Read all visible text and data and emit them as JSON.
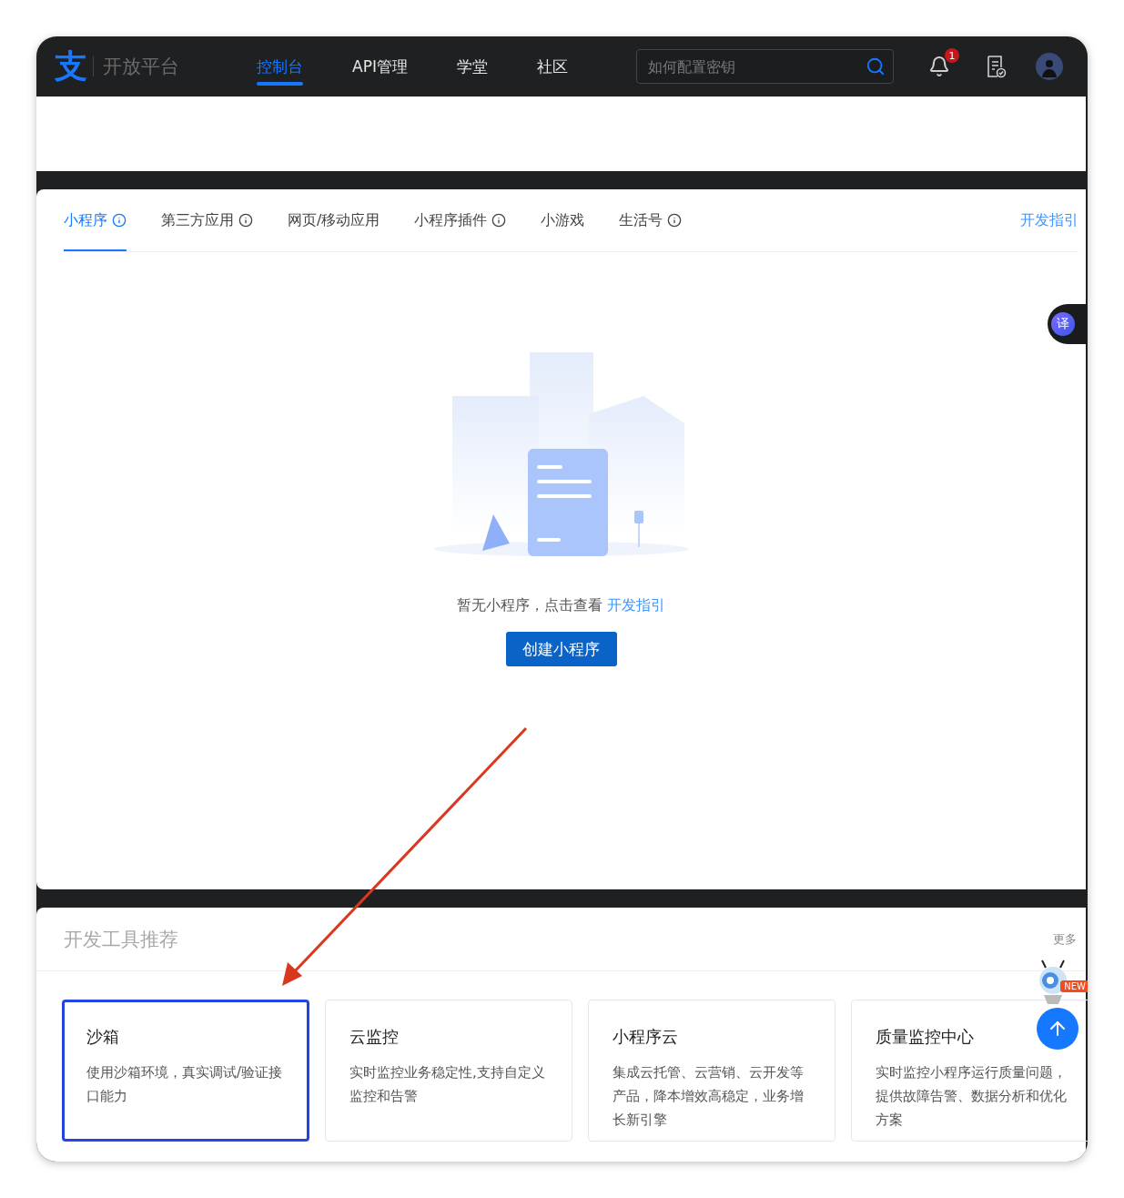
{
  "header": {
    "logo_glyph": "支",
    "brand": "开放平台",
    "nav": [
      {
        "label": "控制台",
        "selected": true
      },
      {
        "label": "API管理",
        "selected": false
      },
      {
        "label": "学堂",
        "selected": false
      },
      {
        "label": "社区",
        "selected": false
      }
    ],
    "search": {
      "placeholder": "如何配置密钥"
    },
    "notification_count": "1"
  },
  "tabs": [
    {
      "label": "小程序",
      "selected": true,
      "info": true
    },
    {
      "label": "第三方应用",
      "selected": false,
      "info": true
    },
    {
      "label": "网页/移动应用",
      "selected": false,
      "info": false
    },
    {
      "label": "小程序插件",
      "selected": false,
      "info": true
    },
    {
      "label": "小游戏",
      "selected": false,
      "info": false
    },
    {
      "label": "生活号",
      "selected": false,
      "info": true
    }
  ],
  "guide_link": "开发指引",
  "translate_button": "译",
  "empty_state": {
    "message": "暂无小程序，点击查看",
    "link": "开发指引",
    "button": "创建小程序"
  },
  "tools": {
    "title": "开发工具推荐",
    "more": "更多",
    "badge": "NEW",
    "cards": [
      {
        "title": "沙箱",
        "description": "使用沙箱环境，真实调试/验证接口能力",
        "selected": true
      },
      {
        "title": "云监控",
        "description": "实时监控业务稳定性,支持自定义监控和告警",
        "selected": false
      },
      {
        "title": "小程序云",
        "description": "集成云托管、云营销、云开发等产品，降本增效高稳定，业务增长新引擎",
        "selected": false
      },
      {
        "title": "质量监控中心",
        "description": "实时监控小程序运行质量问题，提供故障告警、数据分析和优化方案",
        "selected": false
      }
    ]
  }
}
